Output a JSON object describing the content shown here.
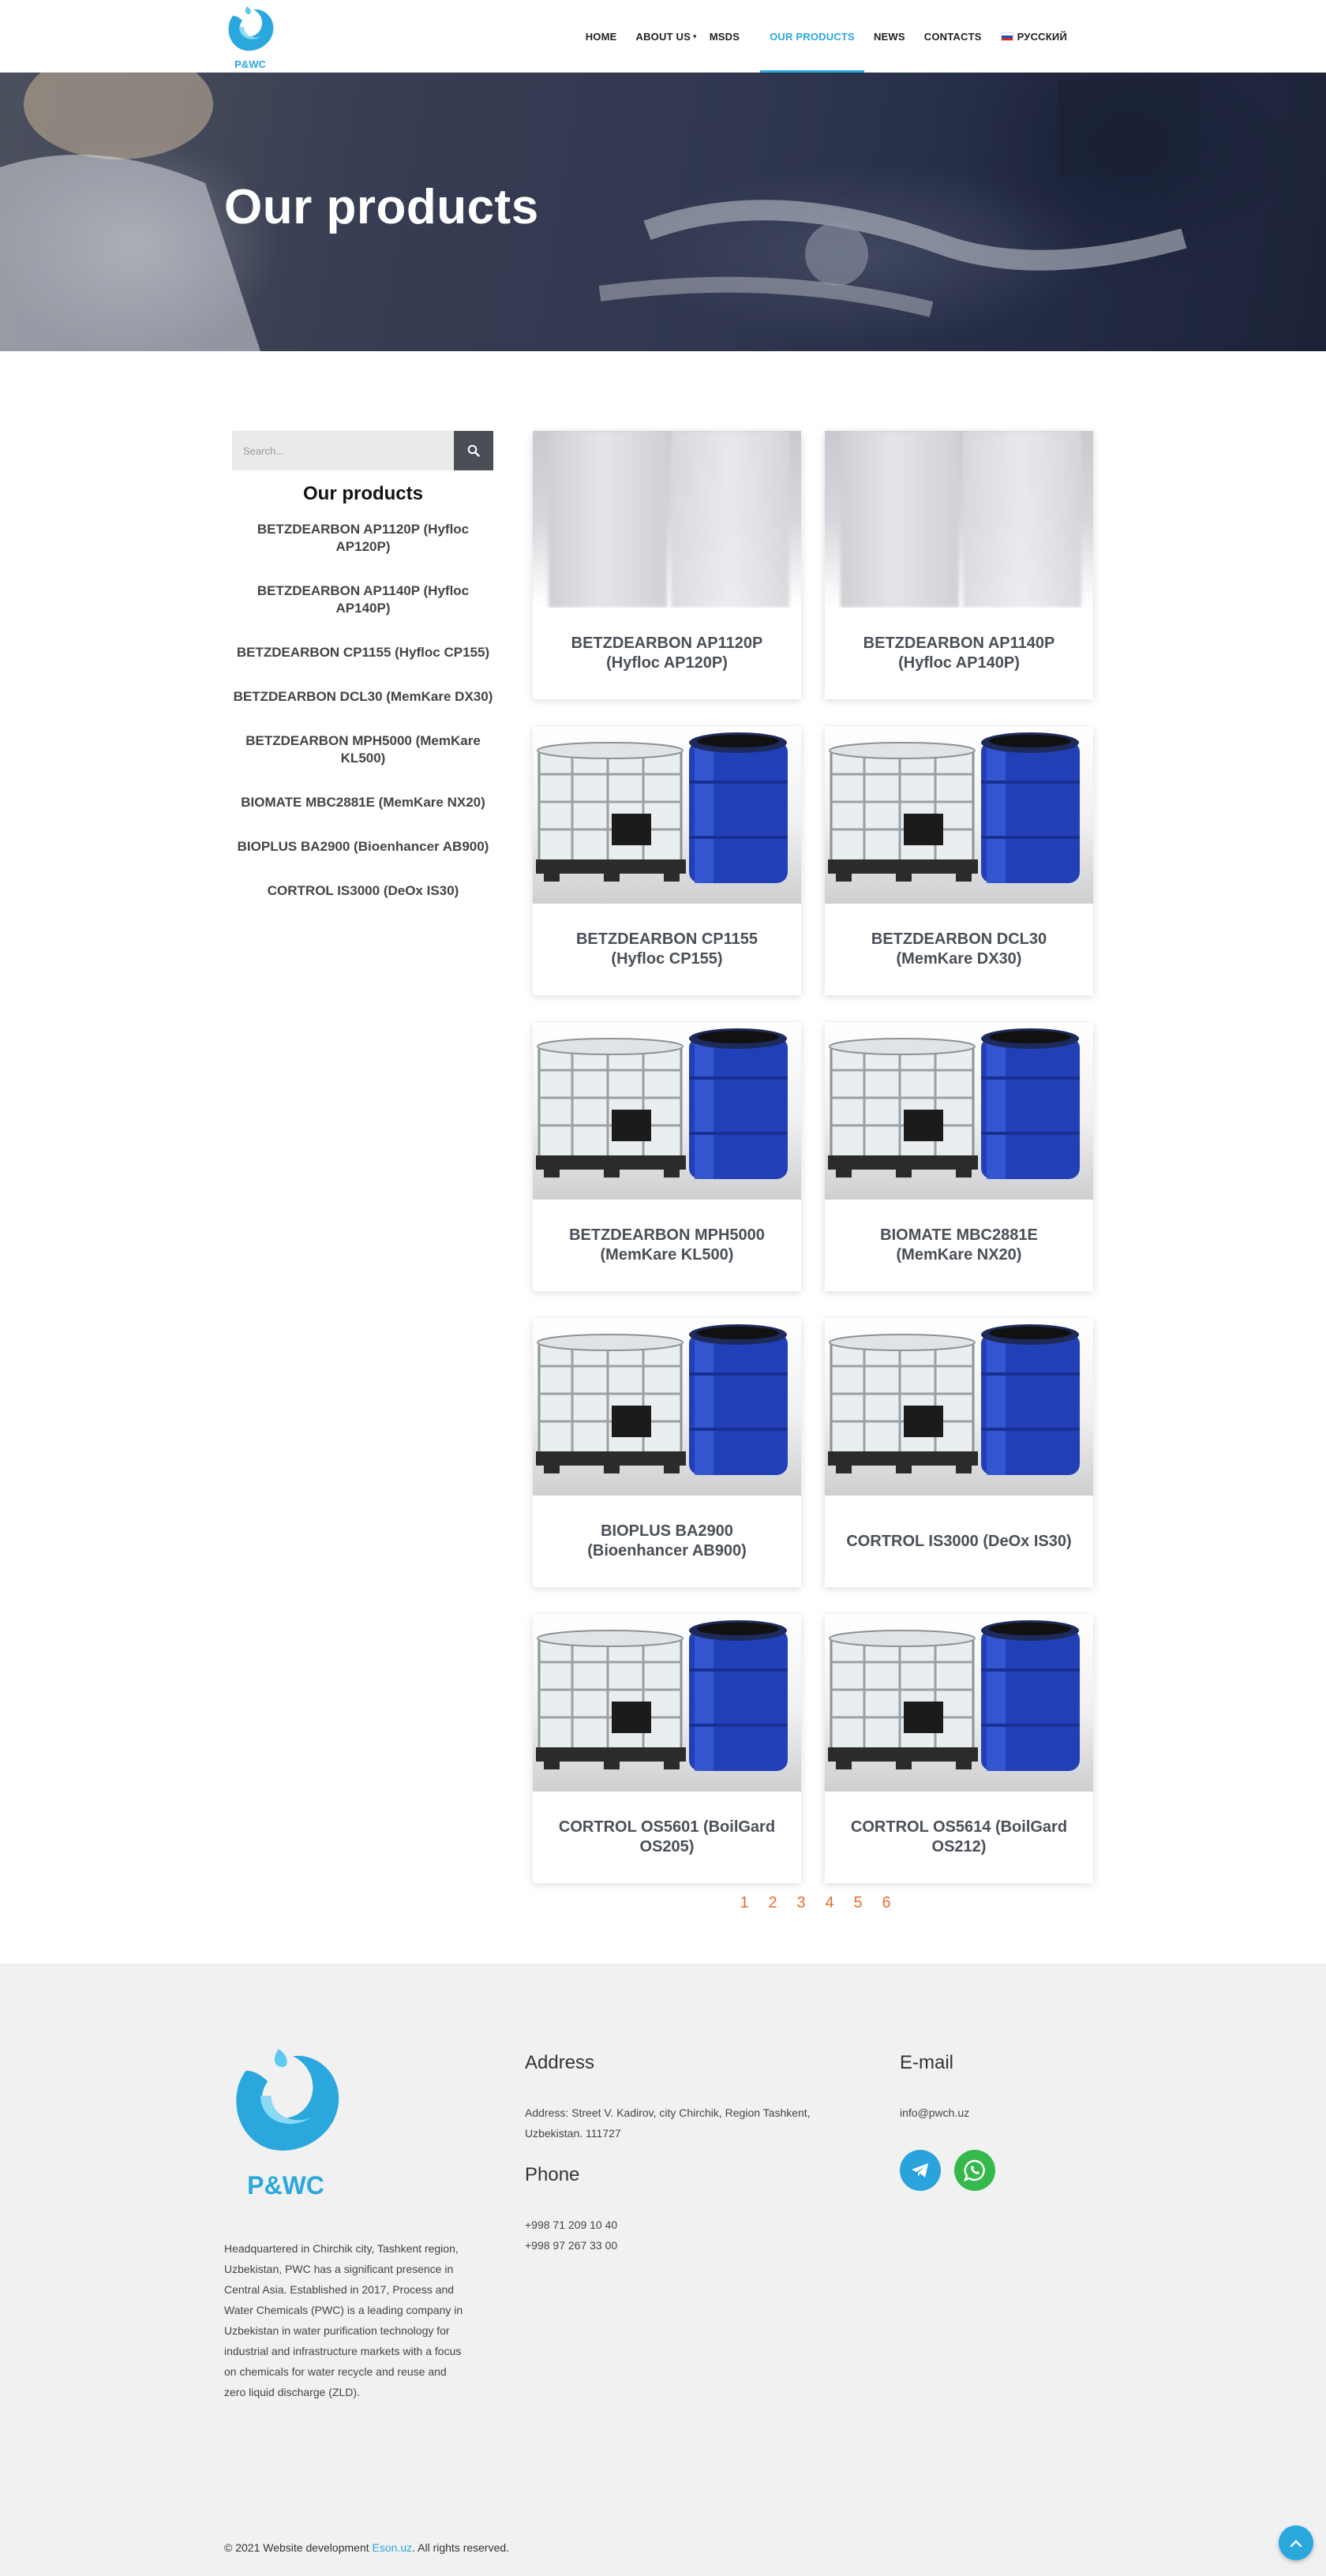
{
  "header": {
    "logo_text": "P&WC",
    "nav": [
      {
        "label": "HOME",
        "active": false
      },
      {
        "label": "ABOUT US",
        "active": false,
        "has_dropdown": true
      },
      {
        "label": "MSDS",
        "active": false
      },
      {
        "label": "OUR PRODUCTS",
        "active": true
      },
      {
        "label": "NEWS",
        "active": false
      },
      {
        "label": "CONTACTS",
        "active": false
      },
      {
        "label": "РУССКИЙ",
        "active": false,
        "icon": "russia-flag-icon"
      }
    ]
  },
  "hero": {
    "title": "Our products"
  },
  "sidebar": {
    "search_placeholder": "Search...",
    "title": "Our products",
    "items": [
      "BETZDEARBON AP1120P (Hyfloc AP120P)",
      "BETZDEARBON AP1140P (Hyfloc AP140P)",
      "BETZDEARBON CP1155 (Hyfloc CP155)",
      "BETZDEARBON DCL30 (MemKare DX30)",
      "BETZDEARBON MPH5000 (MemKare KL500)",
      "BIOMATE MBC2881E (MemKare NX20)",
      "BIOPLUS BA2900 (Bioenhancer AB900)",
      "CORTROL IS3000 (DeOx IS30)"
    ]
  },
  "products": [
    {
      "name": "BETZDEARBON AP1120P (Hyfloc AP120P)",
      "image": "bag"
    },
    {
      "name": "BETZDEARBON AP1140P (Hyfloc AP140P)",
      "image": "bag"
    },
    {
      "name": "BETZDEARBON CP1155 (Hyfloc CP155)",
      "image": "ibc-drum"
    },
    {
      "name": "BETZDEARBON DCL30 (MemKare DX30)",
      "image": "ibc-drum"
    },
    {
      "name": "BETZDEARBON MPH5000 (MemKare KL500)",
      "image": "ibc-drum"
    },
    {
      "name": "BIOMATE MBC2881E (MemKare NX20)",
      "image": "ibc-drum"
    },
    {
      "name": "BIOPLUS BA2900 (Bioenhancer AB900)",
      "image": "ibc-drum"
    },
    {
      "name": "CORTROL IS3000 (DeOx IS30)",
      "image": "ibc-drum"
    },
    {
      "name": "CORTROL OS5601 (BoilGard OS205)",
      "image": "ibc-drum"
    },
    {
      "name": "CORTROL OS5614 (BoilGard OS212)",
      "image": "ibc-drum"
    }
  ],
  "pagination": [
    "1",
    "2",
    "3",
    "4",
    "5",
    "6"
  ],
  "footer": {
    "logo_text": "P&WC",
    "about": "Headquartered in Chirchik city, Tashkent region, Uzbekistan, PWC has a significant presence in Central Asia. Established in 2017, Process and Water Chemicals (PWC) is a leading company in Uzbekistan in water purification technology for industrial and infrastructure markets with a focus on chemicals for water recycle and reuse and zero liquid discharge (ZLD).",
    "address_heading": "Address",
    "address_text": "Address: Street V. Kadirov, city Chirchik, Region Tashkent, Uzbekistan. 111727",
    "phone_heading": "Phone",
    "phones": [
      "+998 71 209 10 40",
      "+998 97 267 33 00"
    ],
    "email_heading": "E-mail",
    "email": "info@pwch.uz",
    "social": [
      "telegram-icon",
      "whatsapp-icon"
    ],
    "copyright_prefix": "© 2021 Website development ",
    "copyright_link": "Eson.uz",
    "copyright_suffix": ". All rights reserved."
  },
  "colors": {
    "accent": "#2aa8de",
    "pagination": "#e46c32",
    "card_title": "#4a4f57",
    "telegram": "#2aa3dc",
    "whatsapp": "#35b94a"
  }
}
